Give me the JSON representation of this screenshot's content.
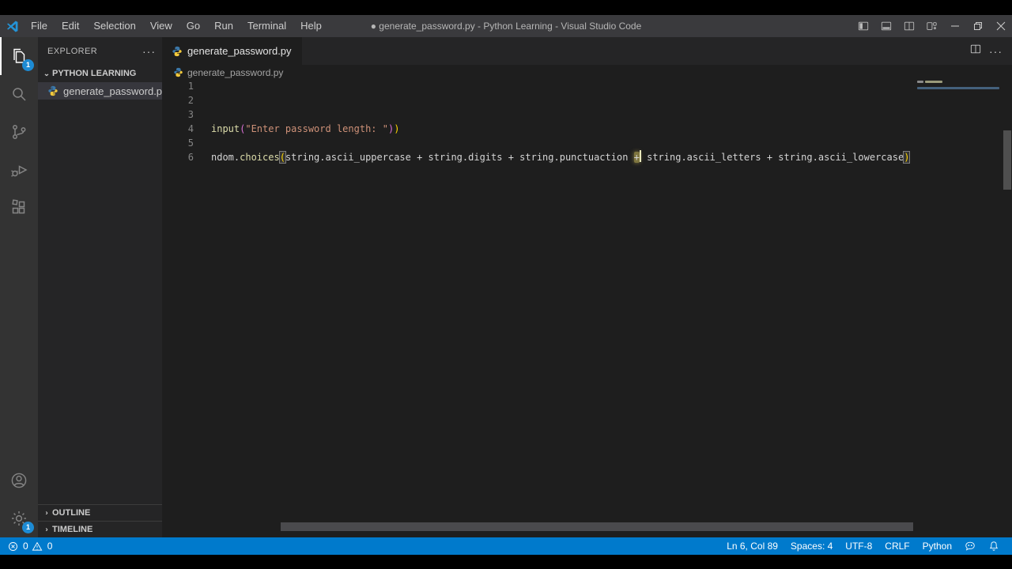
{
  "titlebar": {
    "menus": [
      "File",
      "Edit",
      "Selection",
      "View",
      "Go",
      "Run",
      "Terminal",
      "Help"
    ],
    "title": "● generate_password.py - Python Learning - Visual Studio Code"
  },
  "activity_bar": {
    "explorer_badge": "1",
    "settings_badge": "1"
  },
  "sidebar": {
    "title": "EXPLORER",
    "actions": "···",
    "workspace": "PYTHON LEARNING",
    "file": "generate_password.py",
    "outline_label": "OUTLINE",
    "timeline_label": "TIMELINE"
  },
  "editor": {
    "tab": "generate_password.py",
    "actions_more": "···",
    "breadcrumb": "generate_password.py",
    "lines": [
      {
        "num": "1",
        "tokens": []
      },
      {
        "num": "2",
        "tokens": []
      },
      {
        "num": "3",
        "tokens": []
      },
      {
        "num": "4",
        "tokens": [
          {
            "t": "input"
          },
          {
            "t": "("
          },
          {
            "t": "\"Enter password length: \""
          },
          {
            "t": ")"
          },
          {
            "t": ")"
          }
        ]
      },
      {
        "num": "5",
        "tokens": []
      },
      {
        "num": "6",
        "tokens": [
          {
            "t": "ndom."
          },
          {
            "t": "choices"
          },
          {
            "t": "("
          },
          {
            "t": "string.ascii_uppercase + string.digits + string.punctuaction "
          },
          {
            "t": "+"
          },
          {
            "t": " string.ascii_letters + string.ascii_lowercase"
          },
          {
            "t": ")"
          }
        ]
      }
    ]
  },
  "status_bar": {
    "errors": "0",
    "warnings": "0",
    "cursor_position": "Ln 6, Col 89",
    "indentation": "Spaces: 4",
    "encoding": "UTF-8",
    "eol": "CRLF",
    "language": "Python"
  },
  "colors": {
    "status_bar": "#007acc",
    "badge": "#1d8bd4",
    "activity_bar": "#333333",
    "sidebar": "#252526",
    "editor": "#1e1e1e",
    "titlebar": "#3a3a3d",
    "string_token": "#ce9178",
    "function_token": "#dcdcaa",
    "identifier_token": "#d4d4d4",
    "bracket_gold": "#ffd700",
    "bracket_pink": "#da70d6"
  }
}
